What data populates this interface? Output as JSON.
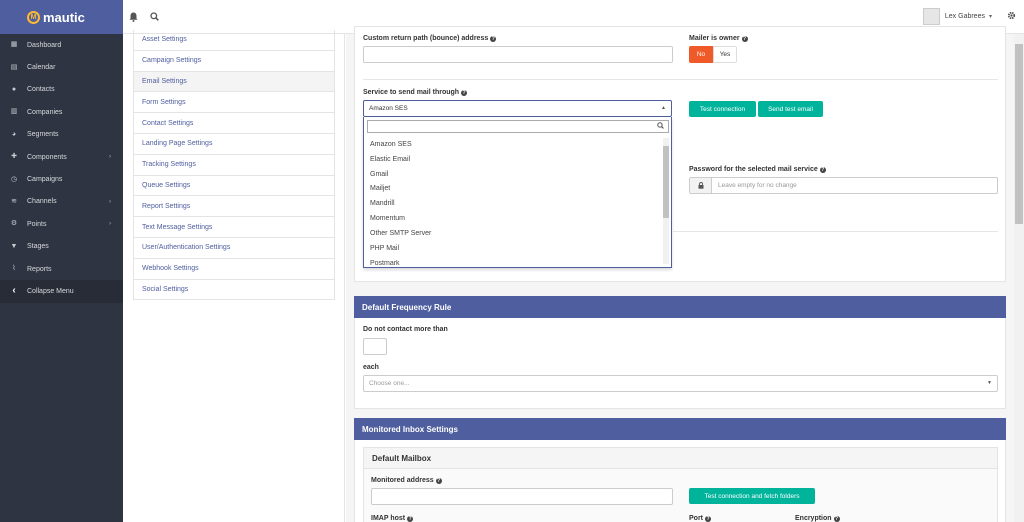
{
  "brand": {
    "name": "mautic",
    "logo_letter": "M",
    "accent": "#4e5e9e",
    "logo_color": "#fdb933"
  },
  "sidebar": {
    "items": [
      {
        "label": "Dashboard",
        "icon": "dashboard-icon",
        "glyph": "▦",
        "caret": ""
      },
      {
        "label": "Calendar",
        "icon": "calendar-icon",
        "glyph": "▤",
        "caret": ""
      },
      {
        "label": "Contacts",
        "icon": "user-icon",
        "glyph": "●",
        "caret": ""
      },
      {
        "label": "Companies",
        "icon": "building-icon",
        "glyph": "▥",
        "caret": ""
      },
      {
        "label": "Segments",
        "icon": "pie-chart-icon",
        "glyph": "◕",
        "caret": ""
      },
      {
        "label": "Components",
        "icon": "puzzle-icon",
        "glyph": "✚",
        "caret": "›"
      },
      {
        "label": "Campaigns",
        "icon": "clock-icon",
        "glyph": "◷",
        "caret": ""
      },
      {
        "label": "Channels",
        "icon": "rss-icon",
        "glyph": "≋",
        "caret": "›"
      },
      {
        "label": "Points",
        "icon": "sliders-icon",
        "glyph": "⚙",
        "caret": "›"
      },
      {
        "label": "Stages",
        "icon": "filter-icon",
        "glyph": "▼",
        "caret": ""
      },
      {
        "label": "Reports",
        "icon": "line-chart-icon",
        "glyph": "⌇",
        "caret": ""
      },
      {
        "label": "Collapse Menu",
        "icon": "chevron-left-icon",
        "glyph": "‹",
        "caret": ""
      }
    ]
  },
  "topbar": {
    "bell_icon": "bell-icon",
    "search_icon": "search-icon",
    "user_name": "Lex Gabrees",
    "user_caret": "▾",
    "gear_icon": "gear-icon"
  },
  "settings_menu": {
    "items": [
      "Asset Settings",
      "Campaign Settings",
      "Email Settings",
      "Form Settings",
      "Contact Settings",
      "Landing Page Settings",
      "Tracking Settings",
      "Queue Settings",
      "Report Settings",
      "Text Message Settings",
      "User/Authentication Settings",
      "Webhook Settings",
      "Social Settings"
    ],
    "active_index": 2
  },
  "mail": {
    "return_path_label": "Custom return path (bounce) address",
    "mailer_owner_label": "Mailer is owner",
    "owner_no": "No",
    "owner_yes": "Yes",
    "service_label": "Service to send mail through",
    "service_value": "Amazon SES",
    "test_connection": "Test connection",
    "send_test_email": "Send test email",
    "password_label": "Password for the selected mail service",
    "password_placeholder": "Leave empty for no change",
    "options": [
      "Amazon SES",
      "Elastic Email",
      "Gmail",
      "Mailjet",
      "Mandrill",
      "Momentum",
      "Other SMTP Server",
      "PHP Mail",
      "Postmark"
    ]
  },
  "frequency": {
    "title": "Default Frequency Rule",
    "dnc_label": "Do not contact more than",
    "each_label": "each",
    "each_placeholder": "Choose one..."
  },
  "inbox": {
    "title": "Monitored Inbox Settings",
    "mailbox_title": "Default Mailbox",
    "address_label": "Monitored address",
    "fetch_button": "Test connection and fetch folders",
    "imap_host_label": "IMAP host",
    "port_label": "Port",
    "encryption_label": "Encryption"
  }
}
